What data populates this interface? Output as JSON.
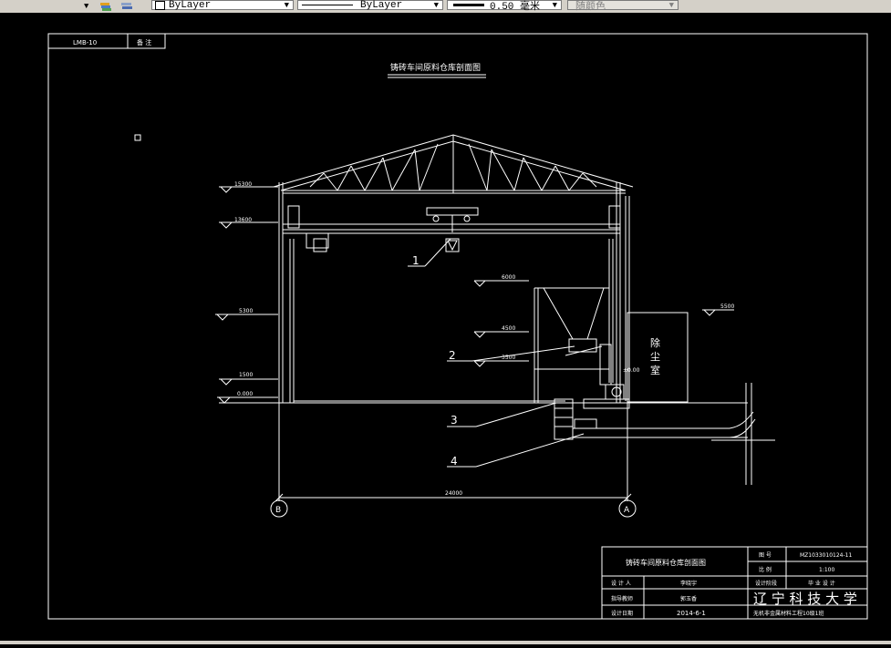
{
  "toolbar": {
    "color_combo": "ByLayer",
    "linetype_combo": "ByLayer",
    "lineweight_combo": "0.50 毫米",
    "plotstyle_combo": "随颜色"
  },
  "drawing": {
    "title": "铸砖车间原料仓库剖面图",
    "corner_label_left": "LMB-10",
    "corner_label_right": "备 注",
    "elevations": [
      "15300",
      "13600",
      "5300",
      "1500",
      "0.000",
      "6000",
      "4500",
      "3500",
      "5500"
    ],
    "callouts": [
      "1",
      "2",
      "3",
      "4"
    ],
    "room_label": [
      "除",
      "尘",
      "室"
    ],
    "dimension": "24000",
    "axis_left": "B",
    "axis_right": "A",
    "small_label": "±0.00"
  },
  "title_block": {
    "drawing_name": "铸砖车间原料仓库剖面图",
    "fields": [
      {
        "label": "图 号",
        "value": "MZ1033010124-11"
      },
      {
        "label": "比 例",
        "value": "1:100"
      }
    ],
    "designer_label": "设 计 人",
    "designer": "李晓宇",
    "stage_label": "设计阶段",
    "stage": "毕 业 设 计",
    "advisor_label": "指导教师",
    "advisor": "郭玉香",
    "date_label": "设计日期",
    "date": "2014-6-1",
    "school": "辽 宁 科 技 大 学",
    "program": "无机非金属材料工程10级1班"
  }
}
